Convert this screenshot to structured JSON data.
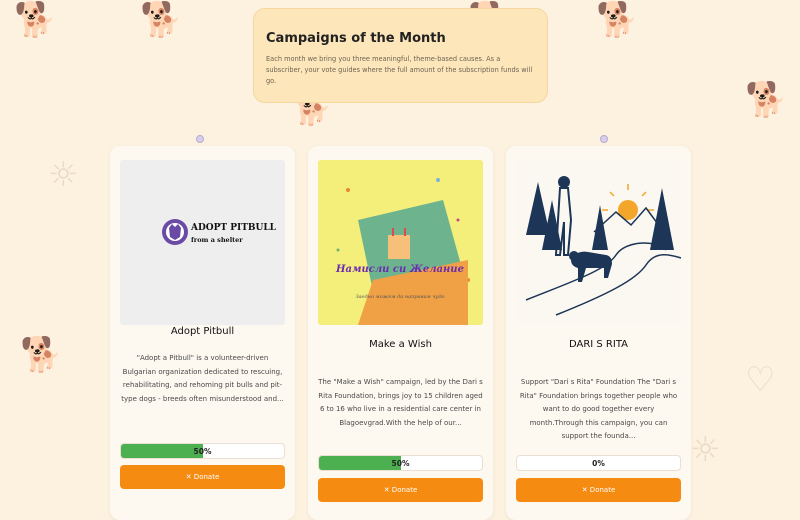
{
  "header": {
    "title": "Campaigns of the Month",
    "description": "Each month we bring you three meaningful, theme-based causes. As a subscriber, your vote guides where the full amount of the subscription funds will go."
  },
  "campaigns": [
    {
      "title": "Adopt Pitbull",
      "logo_title": "ADOPT PITBULL",
      "logo_subtitle": "from a shelter",
      "description": "\"Adopt a Pitbull\" is a volunteer-driven Bulgarian organization dedicated to rescuing, rehabilitating, and rehoming pit bulls and pit-type dogs - breeds often misunderstood and...",
      "progress": 50,
      "progress_label": "50%",
      "button_label": "✕ Donate"
    },
    {
      "title": "Make a Wish",
      "image_text": "Намисли си Желание",
      "image_subtext": "Заедно можем да направим чудо",
      "description": "The \"Make a Wish\" campaign, led by the Dari s Rita Foundation, brings joy to 15 children aged 6 to 16 who live in a residential care center in Blagoevgrad.With the help of our...",
      "progress": 50,
      "progress_label": "50%",
      "button_label": "✕ Donate"
    },
    {
      "title": "DARI S RITA",
      "description": "Support \"Dari s Rita\" Foundation The \"Dari s Rita\" Foundation brings together people who want to do good together every month.Through this campaign, you can support the founda...",
      "progress": 0,
      "progress_label": "0%",
      "button_label": "✕ Donate"
    }
  ],
  "colors": {
    "accent_orange": "#f68b12",
    "progress_green": "#4caf50",
    "header_bg": "#fde6b9",
    "page_bg": "#fdf1e0"
  }
}
